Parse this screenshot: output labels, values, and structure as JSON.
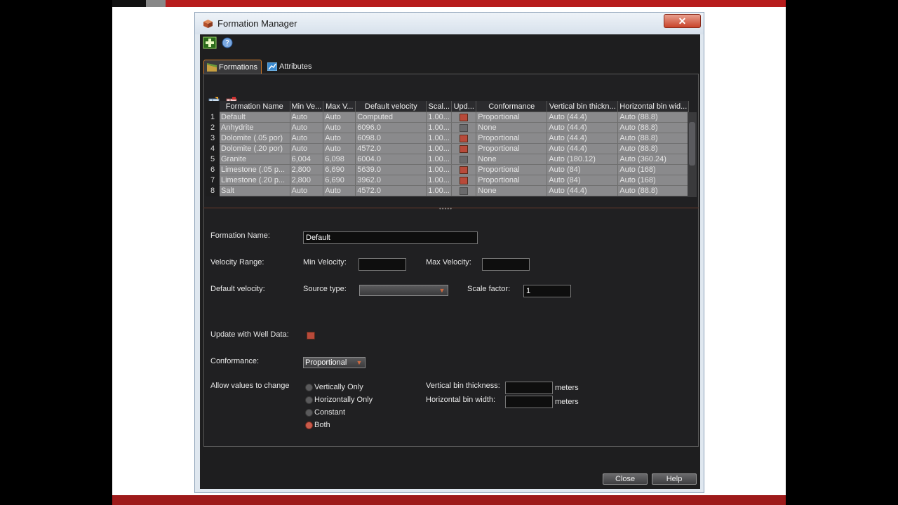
{
  "window": {
    "title": "Formation Manager",
    "close_glyph": "✕"
  },
  "toolbar": {
    "add_icon": "add-icon",
    "help_icon": "help-icon"
  },
  "tabs": [
    {
      "label": "Formations",
      "active": true,
      "icon": "formations-icon"
    },
    {
      "label": "Attributes",
      "active": false,
      "icon": "attributes-icon"
    }
  ],
  "grid": {
    "columns": [
      "Formation Name",
      "Min Ve...",
      "Max V...",
      "Default velocity",
      "Scal...",
      "Upd...",
      "Conformance",
      "Vertical bin thickn...",
      "Horizontal bin wid..."
    ],
    "rows": [
      {
        "n": "1",
        "name": "Default",
        "min": "Auto",
        "max": "Auto",
        "vel": "Computed",
        "scale": "1.00...",
        "upd": true,
        "conf": "Proportional",
        "vbin": "Auto (44.4)",
        "hbin": "Auto (88.8)"
      },
      {
        "n": "2",
        "name": "Anhydrite",
        "min": "Auto",
        "max": "Auto",
        "vel": "6096.0",
        "scale": "1.00...",
        "upd": false,
        "conf": "None",
        "vbin": "Auto (44.4)",
        "hbin": "Auto (88.8)"
      },
      {
        "n": "3",
        "name": "Dolomite (.05 por)",
        "min": "Auto",
        "max": "Auto",
        "vel": "6098.0",
        "scale": "1.00...",
        "upd": true,
        "conf": "Proportional",
        "vbin": "Auto (44.4)",
        "hbin": "Auto (88.8)"
      },
      {
        "n": "4",
        "name": "Dolomite (.20 por)",
        "min": "Auto",
        "max": "Auto",
        "vel": "4572.0",
        "scale": "1.00...",
        "upd": true,
        "conf": "Proportional",
        "vbin": "Auto (44.4)",
        "hbin": "Auto (88.8)"
      },
      {
        "n": "5",
        "name": "Granite",
        "min": "6,004",
        "max": "6,098",
        "vel": "6004.0",
        "scale": "1.00...",
        "upd": false,
        "conf": "None",
        "vbin": "Auto (180.12)",
        "hbin": "Auto (360.24)"
      },
      {
        "n": "6",
        "name": "Limestone (.05 p...",
        "min": "2,800",
        "max": "6,690",
        "vel": "5639.0",
        "scale": "1.00...",
        "upd": true,
        "conf": "Proportional",
        "vbin": "Auto (84)",
        "hbin": "Auto (168)"
      },
      {
        "n": "7",
        "name": "Limestone (.20 p...",
        "min": "2,800",
        "max": "6,690",
        "vel": "3962.0",
        "scale": "1.00...",
        "upd": true,
        "conf": "Proportional",
        "vbin": "Auto (84)",
        "hbin": "Auto (168)"
      },
      {
        "n": "8",
        "name": "Salt",
        "min": "Auto",
        "max": "Auto",
        "vel": "4572.0",
        "scale": "1.00...",
        "upd": false,
        "conf": "None",
        "vbin": "Auto (44.4)",
        "hbin": "Auto (88.8)"
      }
    ]
  },
  "form": {
    "formation_name_label": "Formation Name:",
    "formation_name_value": "Default",
    "velocity_range_label": "Velocity Range:",
    "min_velocity_label": "Min Velocity:",
    "min_velocity_value": "",
    "max_velocity_label": "Max Velocity:",
    "max_velocity_value": "",
    "default_velocity_label": "Default velocity:",
    "source_type_label": "Source type:",
    "source_type_value": "",
    "scale_factor_label": "Scale factor:",
    "scale_factor_value": "1",
    "update_well_label": "Update with Well Data:",
    "update_well_checked": true,
    "conformance_label": "Conformance:",
    "conformance_value": "Proportional",
    "allow_label": "Allow values to change",
    "radios": [
      {
        "label": "Vertically Only",
        "selected": false
      },
      {
        "label": "Horizontally Only",
        "selected": false
      },
      {
        "label": "Constant",
        "selected": false
      },
      {
        "label": "Both",
        "selected": true
      }
    ],
    "vbin_label": "Vertical bin thickness:",
    "vbin_value": "",
    "vbin_unit": "meters",
    "hbin_label": "Horizontal bin width:",
    "hbin_value": "",
    "hbin_unit": "meters"
  },
  "buttons": {
    "close": "Close",
    "help": "Help"
  },
  "colors": {
    "accent": "#d07a2a",
    "dialog_bg": "#1e1e1f",
    "check_red": "#b84a3a",
    "banner_red": "#b71c1c"
  }
}
